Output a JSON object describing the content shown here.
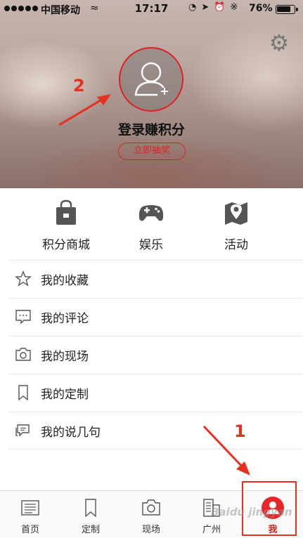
{
  "status_bar": {
    "carrier": "中国移动",
    "time": "17:17",
    "battery_pct": "76%"
  },
  "header": {
    "login_text": "登录赚积分",
    "lottery_label": "立即抽奖"
  },
  "annotations": {
    "label_1": "1",
    "label_2": "2",
    "color": "#e63020"
  },
  "quick_entries": [
    {
      "label": "积分商城",
      "icon": "shopping-bag-icon"
    },
    {
      "label": "娱乐",
      "icon": "gamepad-icon"
    },
    {
      "label": "活动",
      "icon": "map-pin-icon"
    }
  ],
  "menu": [
    {
      "label": "我的收藏",
      "icon": "star-icon"
    },
    {
      "label": "我的评论",
      "icon": "comment-icon"
    },
    {
      "label": "我的现场",
      "icon": "camera-icon"
    },
    {
      "label": "我的定制",
      "icon": "bookmark-icon"
    },
    {
      "label": "我的说几句",
      "icon": "chat-icon"
    }
  ],
  "tabs": [
    {
      "label": "首页",
      "icon": "newspaper-icon"
    },
    {
      "label": "定制",
      "icon": "bookmark-icon"
    },
    {
      "label": "现场",
      "icon": "camera-icon"
    },
    {
      "label": "广州",
      "icon": "building-icon"
    },
    {
      "label": "我",
      "icon": "user-icon",
      "active": true
    }
  ],
  "watermark": "Baidu jingyan",
  "colors": {
    "accent": "#e02020",
    "text": "#222222",
    "divider": "#e6e6e6"
  }
}
